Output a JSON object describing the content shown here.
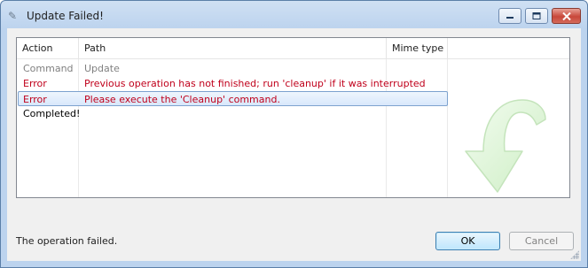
{
  "window": {
    "title": "Update Failed!",
    "icon": "svn-icon"
  },
  "caption_buttons": [
    "minimize",
    "maximize",
    "close"
  ],
  "table": {
    "columns": [
      "Action",
      "Path",
      "Mime type"
    ],
    "rows": [
      {
        "action": "Command",
        "path": "Update",
        "kind": "command"
      },
      {
        "action": "Error",
        "path": "Previous operation has not finished; run 'cleanup' if it was interrupted",
        "kind": "error"
      },
      {
        "action": "Error",
        "path": "Please execute the 'Cleanup' command.",
        "kind": "error",
        "selected": true
      },
      {
        "action": "Completed!",
        "path": "",
        "kind": "done"
      }
    ]
  },
  "status": "The operation failed.",
  "buttons": {
    "ok": "OK",
    "cancel": "Cancel"
  },
  "colors": {
    "error_text": "#c0001b",
    "command_text": "#808080",
    "selection_border": "#7da2ce",
    "arrow_fill": "#dff7d9"
  }
}
